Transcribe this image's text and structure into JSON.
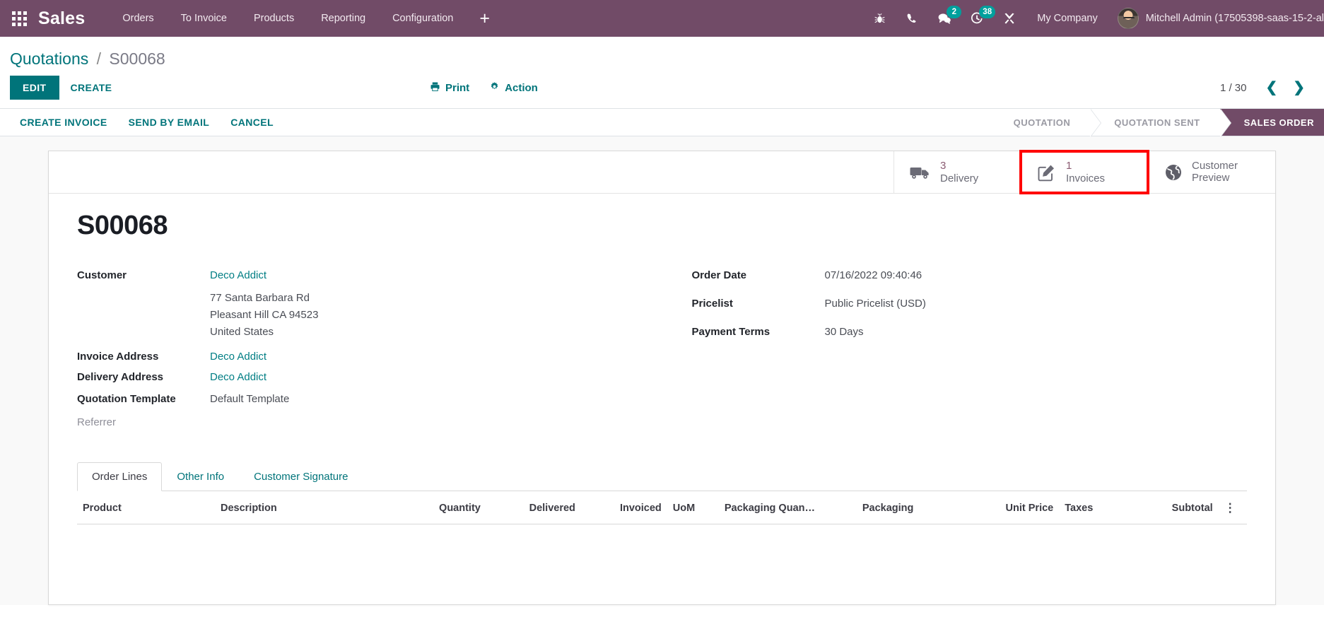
{
  "navbar": {
    "apps_icon": "grid-apps-icon",
    "brand": "Sales",
    "menus": [
      {
        "label": "Orders"
      },
      {
        "label": "To Invoice"
      },
      {
        "label": "Products"
      },
      {
        "label": "Reporting"
      },
      {
        "label": "Configuration"
      }
    ],
    "plus_label": "+",
    "systray": [
      {
        "icon": "bug-icon",
        "badge": ""
      },
      {
        "icon": "phone-icon",
        "badge": ""
      },
      {
        "icon": "messages-icon",
        "badge": "2"
      },
      {
        "icon": "activities-clock-icon",
        "badge": "38"
      },
      {
        "icon": "tools-wrench-icon",
        "badge": ""
      }
    ],
    "company": "My Company",
    "user": "Mitchell Admin (17505398-saas-15-2-al"
  },
  "breadcrumb": {
    "root": "Quotations",
    "separator": "/",
    "current": "S00068"
  },
  "control_panel": {
    "edit_label": "EDIT",
    "create_label": "CREATE",
    "print_label": "Print",
    "action_label": "Action",
    "pager": "1 / 30",
    "prev_icon": "chevron-left-icon",
    "next_icon": "chevron-right-icon"
  },
  "statusbar": {
    "buttons": [
      {
        "label": "CREATE INVOICE"
      },
      {
        "label": "SEND BY EMAIL"
      },
      {
        "label": "CANCEL"
      }
    ],
    "stages": [
      {
        "label": "QUOTATION",
        "active": false
      },
      {
        "label": "QUOTATION SENT",
        "active": false
      },
      {
        "label": "SALES ORDER",
        "active": true
      }
    ],
    "active_color": "#714B67"
  },
  "smart_buttons": [
    {
      "icon": "truck-delivery-icon",
      "value": "3",
      "label": "Delivery",
      "highlighted": false
    },
    {
      "icon": "pencil-square-invoice-icon",
      "value": "1",
      "label": "Invoices",
      "highlighted": true
    },
    {
      "icon": "globe-icon",
      "value": "",
      "label_line1": "Customer",
      "label_line2": "Preview",
      "highlighted": false
    }
  ],
  "highlight_color": "#FF0000",
  "record": {
    "title": "S00068",
    "left_fields": [
      {
        "label": "Customer",
        "value": "Deco Addict",
        "link": true
      },
      {
        "label": "Invoice Address",
        "value": "Deco Addict",
        "link": true
      },
      {
        "label": "Delivery Address",
        "value": "Deco Addict",
        "link": true
      },
      {
        "label": "Quotation Template",
        "value": "Default Template",
        "link": false
      },
      {
        "label": "Referrer",
        "value": "",
        "link": false,
        "muted_label": true
      }
    ],
    "customer_address": [
      "77 Santa Barbara Rd",
      "Pleasant Hill CA 94523",
      "United States"
    ],
    "right_fields": [
      {
        "label": "Order Date",
        "value": "07/16/2022 09:40:46"
      },
      {
        "label": "Pricelist",
        "value": "Public Pricelist (USD)"
      },
      {
        "label": "Payment Terms",
        "value": "30 Days"
      }
    ]
  },
  "notebook": {
    "tabs": [
      {
        "label": "Order Lines",
        "active": true
      },
      {
        "label": "Other Info",
        "active": false
      },
      {
        "label": "Customer Signature",
        "active": false
      }
    ],
    "columns": [
      "Product",
      "Description",
      "Quantity",
      "Delivered",
      "Invoiced",
      "UoM",
      "Packaging Quan…",
      "Packaging",
      "Unit Price",
      "Taxes",
      "Subtotal"
    ],
    "optional_columns_icon": "vertical-dots-icon"
  }
}
